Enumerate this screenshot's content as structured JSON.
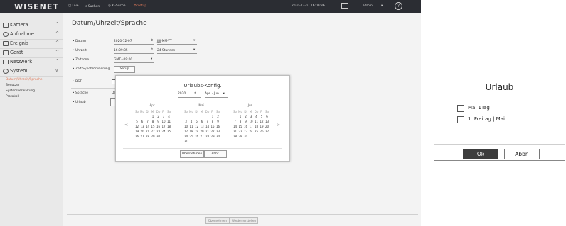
{
  "app": {
    "logo": "WISENET",
    "nav": {
      "live": "Live",
      "suchen": "Suchen",
      "ki_suche": "KI-Suche",
      "setup": "Setup"
    },
    "datetime": "2020-12-07 16:09:36",
    "user": "admin",
    "help_glyph": "?"
  },
  "sidebar": {
    "items": [
      {
        "label": "Kamera",
        "icon": "camera-icon",
        "chevron": "^"
      },
      {
        "label": "Aufnahme",
        "icon": "record-icon",
        "chevron": "^"
      },
      {
        "label": "Ereignis",
        "icon": "event-icon",
        "chevron": "^"
      },
      {
        "label": "Gerät",
        "icon": "device-icon",
        "chevron": "^"
      },
      {
        "label": "Netzwerk",
        "icon": "network-icon",
        "chevron": "^"
      },
      {
        "label": "System",
        "icon": "system-icon",
        "chevron": "v"
      }
    ],
    "subitems": [
      "Datum/Uhrzeit/Sprache",
      "Benutzer",
      "Systemverwaltung",
      "Protokoll"
    ]
  },
  "page": {
    "title": "Datum/Uhrzeit/Sprache",
    "fields": {
      "datum_label": "Datum",
      "datum_value": "2020-12-07",
      "datum_format": "JJJJ-MM-TT",
      "uhrzeit_label": "Uhrzeit",
      "uhrzeit_value": "16:09:35",
      "uhrzeit_format": "24 Stunden",
      "zeitzone_label": "Zeitzone",
      "zeitzone_value": "GMT+09:00",
      "zeitsync_label": "Zeit-Synchronisierung",
      "setup_button": "Setup",
      "dst_label": "DST",
      "sprache_label": "Sprache",
      "sprache_value": "Deutsch",
      "urlaub_label": "Urlaub"
    },
    "bottom_buttons": {
      "apply": "Übernehmen",
      "restore": "Wiederherstellen"
    }
  },
  "urlaubs_konfig": {
    "title": "Urlaubs-Konfig.",
    "year": "2020",
    "month_range": "Apr. - Jun.",
    "weekdays": [
      "So",
      "Mo",
      "Di",
      "Mi",
      "Do",
      "Fr",
      "Sa"
    ],
    "months": [
      {
        "name": "Apr",
        "offset": 3,
        "days": 30
      },
      {
        "name": "Mai",
        "offset": 5,
        "days": 31
      },
      {
        "name": "Jun",
        "offset": 1,
        "days": 30
      }
    ],
    "prev_glyph": "<",
    "next_glyph": ">",
    "apply_button": "Übernehmen",
    "cancel_button": "Abbr."
  },
  "urlaub_dialog": {
    "title": "Urlaub",
    "options": [
      "Mai 1Tag",
      "1. Freitag | Mai"
    ],
    "ok_button": "Ok",
    "cancel_button": "Abbr."
  }
}
